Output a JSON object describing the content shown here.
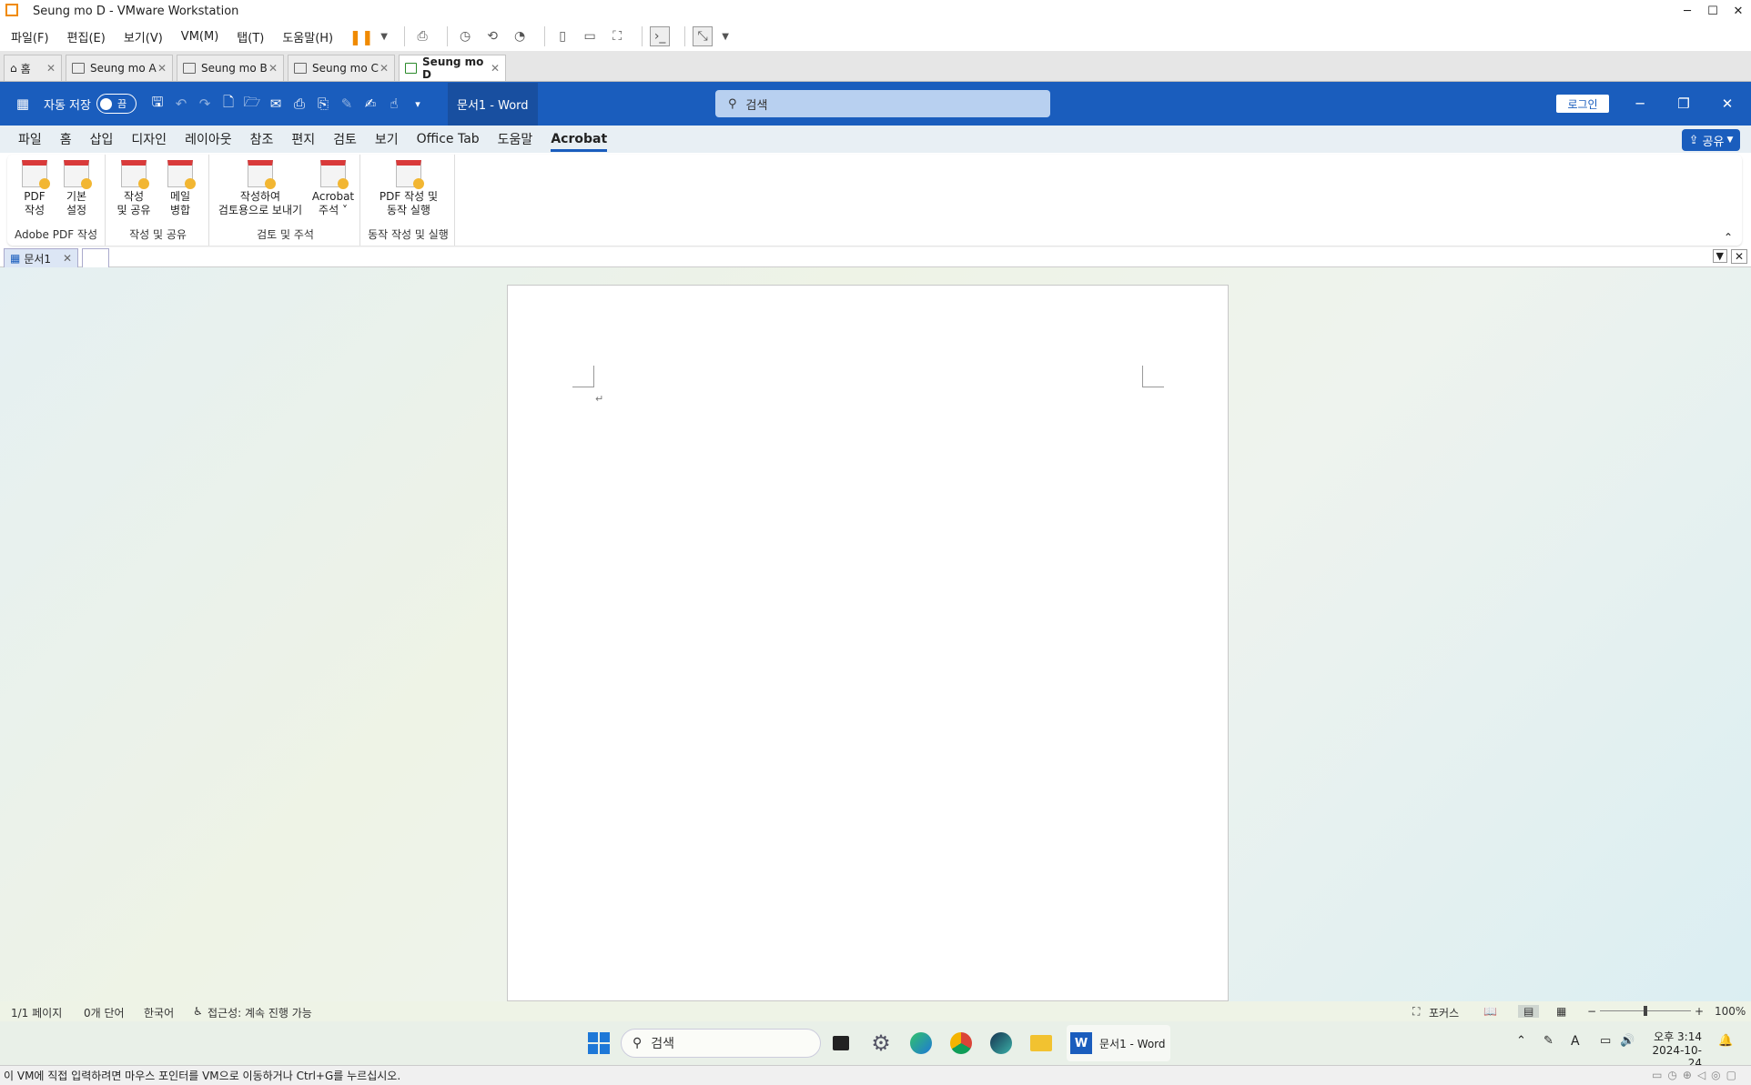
{
  "vm": {
    "title": "Seung mo D - VMware Workstation",
    "menu": [
      "파일(F)",
      "편집(E)",
      "보기(V)",
      "VM(M)",
      "탭(T)",
      "도움말(H)"
    ],
    "tabs": [
      "홈",
      "Seung mo A",
      "Seung mo B",
      "Seung mo C",
      "Seung mo D"
    ],
    "status_message": "이 VM에 직접 입력하려면 마우스 포인터를 VM으로 이동하거나 Ctrl+G를 누르십시오."
  },
  "word": {
    "autosave_label": "자동 저장",
    "autosave_state": "끔",
    "doc_title": "문서1  -  Word",
    "search_placeholder": "검색",
    "login_label": "로그인",
    "share_label": "공유",
    "ribbon_tabs": [
      "파일",
      "홈",
      "삽입",
      "디자인",
      "레이아웃",
      "참조",
      "편지",
      "검토",
      "보기",
      "Office Tab",
      "도움말",
      "Acrobat"
    ],
    "ribbon": {
      "groups": [
        {
          "label": "Adobe PDF 작성",
          "buttons": [
            [
              "PDF",
              "작성"
            ],
            [
              "기본",
              "설정"
            ]
          ]
        },
        {
          "label": "작성 및 공유",
          "buttons": [
            [
              "작성",
              "및 공유"
            ],
            [
              "메일",
              "병합"
            ]
          ]
        },
        {
          "label": "검토 및 주석",
          "buttons": [
            [
              "작성하여",
              "검토용으로 보내기"
            ],
            [
              "Acrobat",
              "주석 ˅"
            ]
          ]
        },
        {
          "label": "동작 작성 및 실행",
          "buttons": [
            [
              "PDF 작성 및",
              "동작 실행"
            ]
          ]
        }
      ]
    },
    "doc_tab": "문서1",
    "status": {
      "page": "1/1 페이지",
      "words": "0개 단어",
      "language": "한국어",
      "accessibility": "접근성: 계속 진행 가능",
      "focus": "포커스",
      "zoom": "100%"
    }
  },
  "taskbar": {
    "search_placeholder": "검색",
    "active_app": "문서1 - Word",
    "time": "오후 3:14",
    "date": "2024-10-24"
  }
}
